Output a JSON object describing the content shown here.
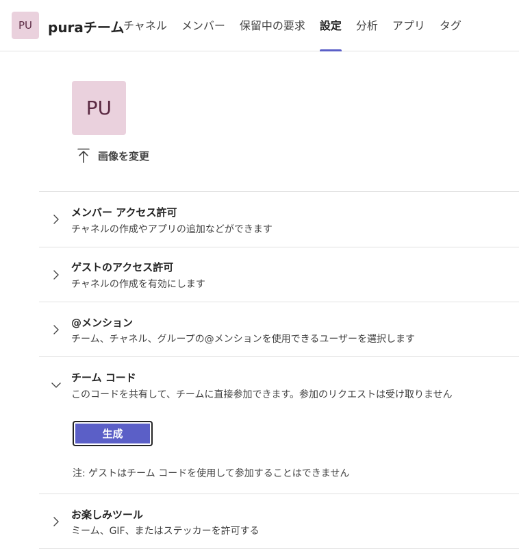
{
  "header": {
    "avatar_initials": "PU",
    "team_name": "puraチーム",
    "tabs": [
      {
        "label": "チャネル"
      },
      {
        "label": "メンバー"
      },
      {
        "label": "保留中の要求"
      },
      {
        "label": "設定"
      },
      {
        "label": "分析"
      },
      {
        "label": "アプリ"
      },
      {
        "label": "タグ"
      }
    ],
    "active_tab": "設定"
  },
  "team_picture": {
    "avatar_initials": "PU",
    "change_label": "画像を変更"
  },
  "sections": [
    {
      "title": "メンバー アクセス許可",
      "description": "チャネルの作成やアプリの追加などができます",
      "expanded": false
    },
    {
      "title": "ゲストのアクセス許可",
      "description": "チャネルの作成を有効にします",
      "expanded": false
    },
    {
      "title": "@メンション",
      "description": "チーム、チャネル、グループの@メンションを使用できるユーザーを選択します",
      "expanded": false
    },
    {
      "title": "チーム コード",
      "description": "このコードを共有して、チームに直接参加できます。参加のリクエストは受け取りません",
      "expanded": true
    },
    {
      "title": "お楽しみツール",
      "description": "ミーム、GIF、またはステッカーを許可する",
      "expanded": false
    }
  ],
  "team_code": {
    "generate_label": "生成",
    "note": "注: ゲストはチーム コードを使用して参加することはできません"
  },
  "colors": {
    "accent": "#5b5fc7",
    "avatar_bg": "#ead1dd",
    "divider": "#e0e0e0"
  }
}
